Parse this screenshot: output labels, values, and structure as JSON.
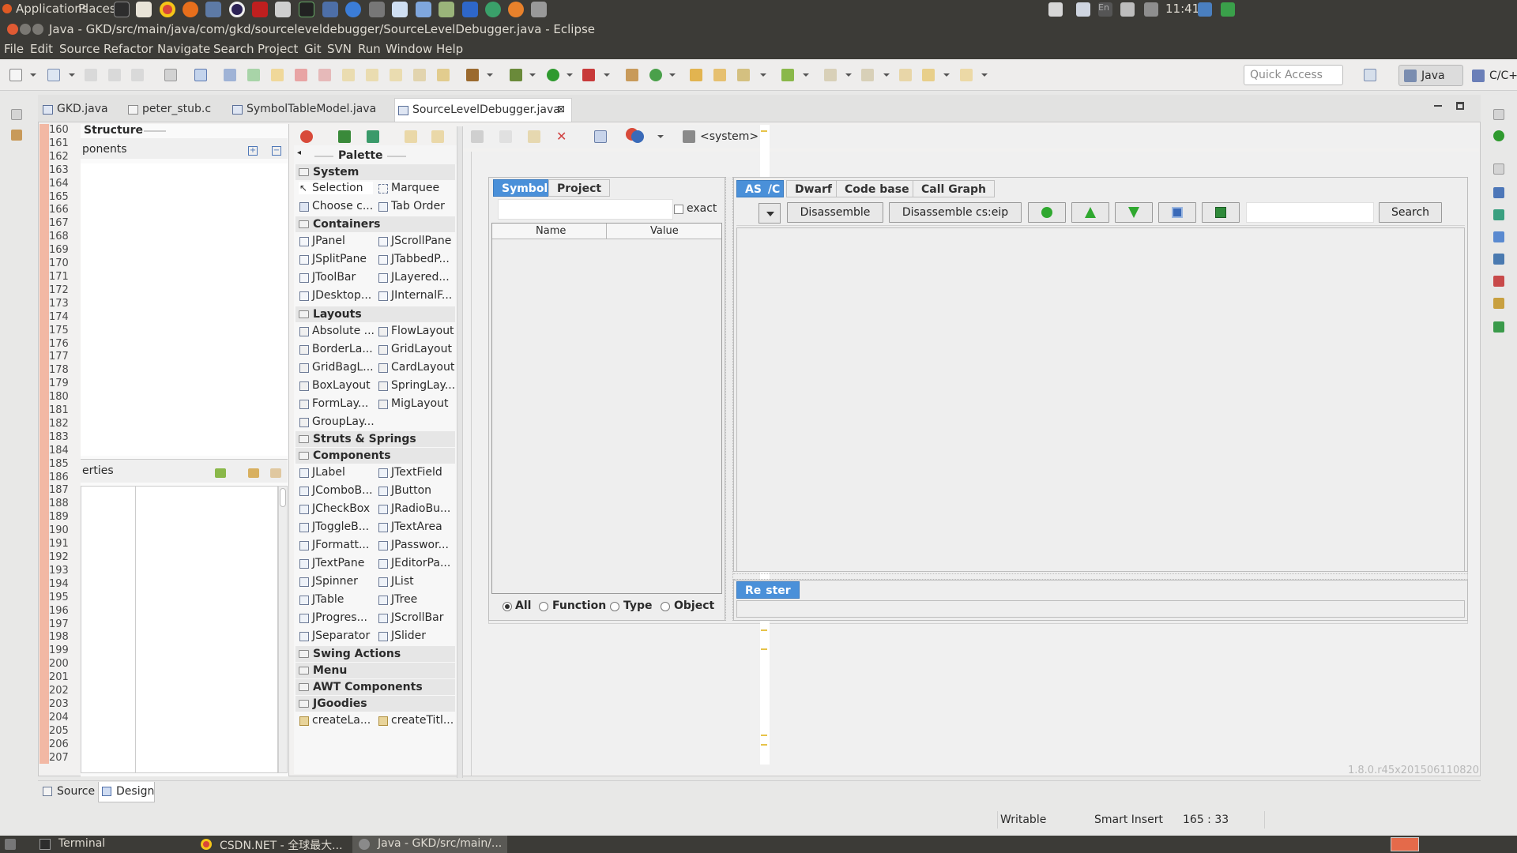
{
  "system_panel": {
    "applications": "Applications",
    "places": "Places",
    "clock": "11:41",
    "lang": "En"
  },
  "window": {
    "title": "Java - GKD/src/main/java/com/gkd/sourceleveldebugger/SourceLevelDebugger.java - Eclipse"
  },
  "menu": [
    "File",
    "Edit",
    "Source",
    "Refactor",
    "Navigate",
    "Search",
    "Project",
    "Git",
    "SVN",
    "Run",
    "Window",
    "Help"
  ],
  "toolbar": {
    "quick_access_placeholder": "Quick Access",
    "perspective_java": "Java",
    "perspective_cpp": "C/C++"
  },
  "editor_tabs": [
    "GKD.java",
    "peter_stub.c",
    "SymbolTableModel.java",
    "SourceLevelDebugger.java"
  ],
  "line_numbers": [
    "160",
    "161",
    "162",
    "163",
    "164",
    "165",
    "166",
    "167",
    "168",
    "169",
    "170",
    "171",
    "172",
    "173",
    "174",
    "175",
    "176",
    "177",
    "178",
    "179",
    "180",
    "181",
    "182",
    "183",
    "184",
    "185",
    "186",
    "187",
    "188",
    "189",
    "190",
    "191",
    "192",
    "193",
    "194",
    "195",
    "196",
    "197",
    "198",
    "199",
    "200",
    "201",
    "202",
    "203",
    "204",
    "205",
    "206",
    "207"
  ],
  "structure": {
    "title": "Structure",
    "components_label": "ponents",
    "properties_label": "erties"
  },
  "palette": {
    "title": "Palette",
    "cat_system": "System",
    "system_items": [
      "Selection",
      "Marquee",
      "Choose c...",
      "Tab Order"
    ],
    "cat_containers": "Containers",
    "container_items": [
      "JPanel",
      "JScrollPane",
      "JSplitPane",
      "JTabbedP...",
      "JToolBar",
      "JLayered...",
      "JDesktop...",
      "JInternalF..."
    ],
    "cat_layouts": "Layouts",
    "layout_items": [
      "Absolute ...",
      "FlowLayout",
      "BorderLa...",
      "GridLayout",
      "GridBagL...",
      "CardLayout",
      "BoxLayout",
      "SpringLay...",
      "FormLay...",
      "MigLayout",
      "GroupLay..."
    ],
    "cat_struts": "Struts & Springs",
    "cat_components": "Components",
    "component_items": [
      "JLabel",
      "JTextField",
      "JComboB...",
      "JButton",
      "JCheckBox",
      "JRadioBu...",
      "JToggleB...",
      "JTextArea",
      "JFormatt...",
      "JPasswor...",
      "JTextPane",
      "JEditorPa...",
      "JSpinner",
      "JList",
      "JTable",
      "JTree",
      "JProgres...",
      "JScrollBar",
      "JSeparator",
      "JSlider"
    ],
    "cat_swing_actions": "Swing Actions",
    "cat_menu": "Menu",
    "cat_awt": "AWT Components",
    "cat_jgoodies": "JGoodies",
    "jgoodies_items": [
      "createLa...",
      "createTitl..."
    ]
  },
  "design_toolbar": {
    "system_label": "<system>"
  },
  "designer": {
    "left_tabs": [
      "Symbol",
      "Project"
    ],
    "exact_label": "exact",
    "table_headers": [
      "Name",
      "Value"
    ],
    "radios": [
      "All",
      "Function",
      "Type",
      "Object"
    ],
    "right_tabs": [
      "AS",
      "/C",
      "Dwarf",
      "Code base",
      "Call Graph"
    ],
    "buttons": {
      "disassemble": "Disassemble",
      "disassemble_cseip": "Disassemble cs:eip",
      "search": "Search"
    },
    "register_tab": "Re",
    "register_tab_rest": "ster",
    "version": "1.8.0.r45x201506110820"
  },
  "bottom_tabs": [
    "Source",
    "Design"
  ],
  "status": {
    "writable": "Writable",
    "insert": "Smart Insert",
    "position": "165 : 33"
  },
  "taskbar": [
    "Terminal",
    "CSDN.NET - 全球最大...",
    "Java - GKD/src/main/..."
  ],
  "colors": {
    "panel": "#3c3b37",
    "gutter": "#f2b8a4",
    "accent_tab": "#4a90d9"
  }
}
